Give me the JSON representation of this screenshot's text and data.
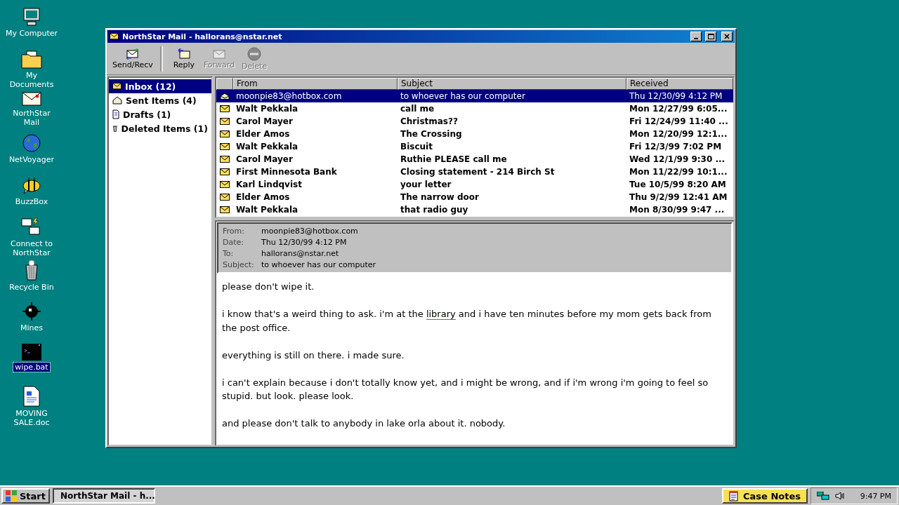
{
  "desktop_icons": [
    {
      "label": "My Computer",
      "kind": "computer",
      "selected": false
    },
    {
      "label": "My Documents",
      "kind": "folder",
      "selected": false
    },
    {
      "label": "NorthStar Mail",
      "kind": "mail",
      "selected": false
    },
    {
      "label": "NetVoyager",
      "kind": "globe",
      "selected": false
    },
    {
      "label": "BuzzBox",
      "kind": "bee",
      "selected": false
    },
    {
      "label": "Connect to NorthStar",
      "kind": "network",
      "selected": false
    },
    {
      "label": "Recycle Bin",
      "kind": "bin",
      "selected": false
    },
    {
      "label": "Mines",
      "kind": "mine",
      "selected": false
    },
    {
      "label": "wipe.bat",
      "kind": "terminal",
      "selected": true
    },
    {
      "label": "MOVING SALE.doc",
      "kind": "document",
      "selected": false
    }
  ],
  "window": {
    "title": "NorthStar Mail - hallorans@nstar.net",
    "toolbar": [
      {
        "label": "Send/Recv",
        "kind": "sendrecv",
        "disabled": false
      },
      {
        "label": "Reply",
        "kind": "reply",
        "disabled": false
      },
      {
        "label": "Forward",
        "kind": "forward",
        "disabled": true
      },
      {
        "label": "Delete",
        "kind": "delete",
        "disabled": true
      }
    ],
    "folders": [
      {
        "label": "Inbox (12)",
        "kind": "inbox",
        "selected": true
      },
      {
        "label": "Sent Items (4)",
        "kind": "sent",
        "selected": false
      },
      {
        "label": "Drafts (1)",
        "kind": "drafts",
        "selected": false
      },
      {
        "label": "Deleted Items (1)",
        "kind": "deleted",
        "selected": false
      }
    ],
    "message_list": {
      "columns": [
        "From",
        "Subject",
        "Received"
      ],
      "rows": [
        {
          "from": "moonpie83@hotbox.com",
          "subject": "to whoever has our computer",
          "received": "Thu 12/30/99 4:12 PM",
          "unread": false,
          "selected": true
        },
        {
          "from": "Walt Pekkala",
          "subject": "call me",
          "received": "Mon 12/27/99 6:05...",
          "unread": true,
          "selected": false
        },
        {
          "from": "Carol Mayer",
          "subject": "Christmas??",
          "received": "Fri 12/24/99 11:40 ...",
          "unread": true,
          "selected": false
        },
        {
          "from": "Elder Amos",
          "subject": "The Crossing",
          "received": "Mon 12/20/99 12:1...",
          "unread": true,
          "selected": false
        },
        {
          "from": "Walt Pekkala",
          "subject": "Biscuit",
          "received": "Fri 12/3/99 7:02 PM",
          "unread": true,
          "selected": false
        },
        {
          "from": "Carol Mayer",
          "subject": "Ruthie PLEASE call me",
          "received": "Wed 12/1/99 9:30 ...",
          "unread": true,
          "selected": false
        },
        {
          "from": "First Minnesota Bank",
          "subject": "Closing statement - 214 Birch St",
          "received": "Mon 11/22/99 10:1...",
          "unread": true,
          "selected": false
        },
        {
          "from": "Karl Lindqvist",
          "subject": "your letter",
          "received": "Tue 10/5/99 8:20 AM",
          "unread": true,
          "selected": false
        },
        {
          "from": "Elder Amos",
          "subject": "The narrow door",
          "received": "Thu 9/2/99 12:41 AM",
          "unread": true,
          "selected": false
        },
        {
          "from": "Walt Pekkala",
          "subject": "that radio guy",
          "received": "Mon 8/30/99 9:47 ...",
          "unread": true,
          "selected": false
        }
      ]
    },
    "preview": {
      "headers": [
        {
          "label": "From:",
          "value": "moonpie83@hotbox.com"
        },
        {
          "label": "Date:",
          "value": "Thu 12/30/99 4:12 PM"
        },
        {
          "label": "To:",
          "value": "hallorans@nstar.net"
        },
        {
          "label": "Subject:",
          "value": "to whoever has our computer"
        }
      ],
      "paragraphs": [
        [
          {
            "kind": "text",
            "text": "please don't wipe it."
          }
        ],
        [
          {
            "kind": "text",
            "text": "i know that's a weird thing to ask. i'm at the "
          },
          {
            "kind": "link",
            "text": "library"
          },
          {
            "kind": "text",
            "text": " and i have ten minutes before my mom gets back from the post office."
          }
        ],
        [
          {
            "kind": "text",
            "text": "everything is still on there. i made sure."
          }
        ],
        [
          {
            "kind": "text",
            "text": "i can't explain because i don't totally know yet, and i might be wrong, and if i'm wrong i'm going to feel so stupid. but look. please look."
          }
        ],
        [
          {
            "kind": "text",
            "text": "and please don't talk to anybody in lake orla about it. nobody."
          }
        ]
      ]
    }
  },
  "taskbar": {
    "start": "Start",
    "tasks": [
      {
        "label": "NorthStar Mail - h...",
        "active": true
      }
    ],
    "pinned": {
      "label": "Case Notes",
      "highlighted": true
    },
    "clock": "9:47 PM"
  }
}
